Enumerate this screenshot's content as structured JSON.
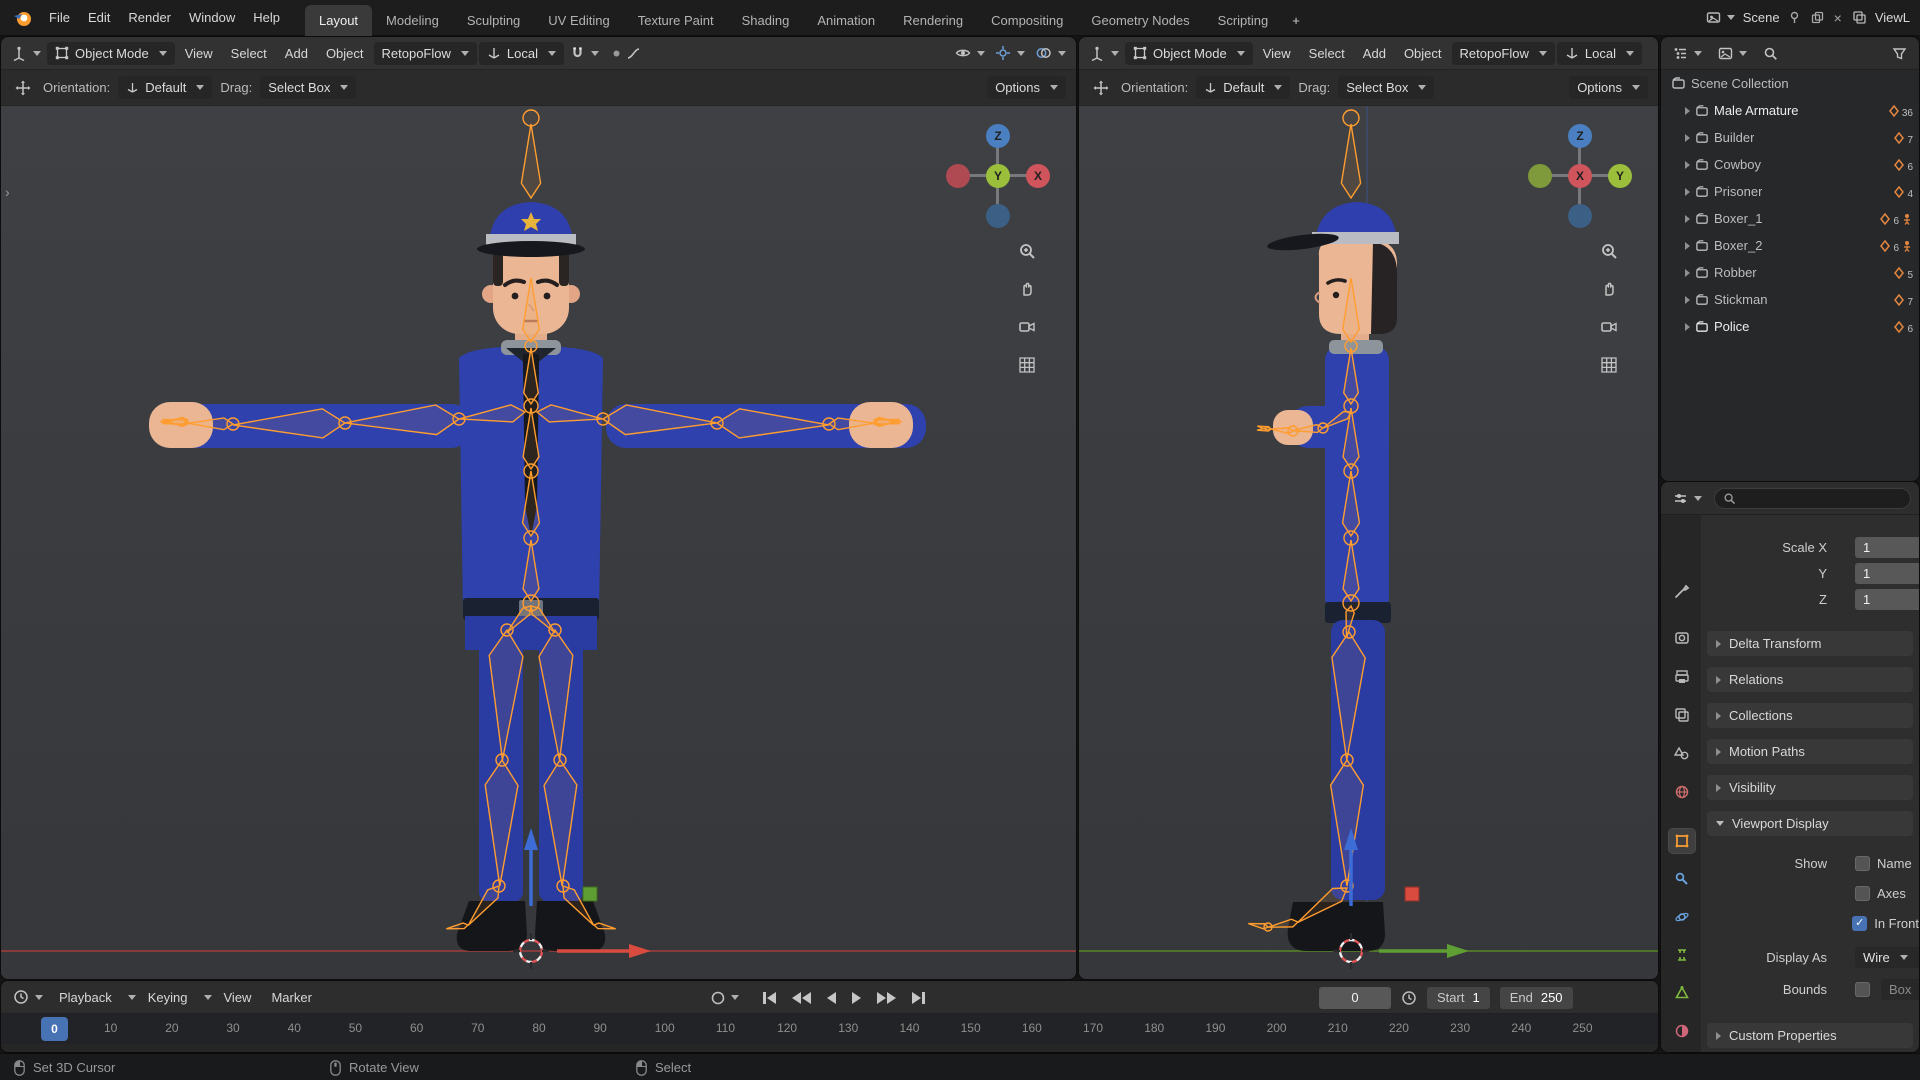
{
  "colors": {
    "accent_blue": "#4772b3",
    "selection_orange": "#ff9d30",
    "axis_x": "#d0545c",
    "axis_y": "#9bbf3b",
    "axis_z": "#4a7fc1",
    "uniform_blue": "#2e41ad"
  },
  "topbar": {
    "menus": [
      "File",
      "Edit",
      "Render",
      "Window",
      "Help"
    ],
    "tabs": [
      "Layout",
      "Modeling",
      "Sculpting",
      "UV Editing",
      "Texture Paint",
      "Shading",
      "Animation",
      "Rendering",
      "Compositing",
      "Geometry Nodes",
      "Scripting"
    ],
    "new_workspace": "+",
    "scene_name": "Scene",
    "view_layer_name": "ViewL"
  },
  "viewport_left": {
    "mode": "Object Mode",
    "menu_view": "View",
    "menu_select": "Select",
    "menu_add": "Add",
    "menu_object": "Object",
    "retopoflow": "RetopoFlow",
    "pivot": "Local",
    "orientation_label": "Orientation:",
    "orientation_value": "Default",
    "drag_label": "Drag:",
    "drag_value": "Select Box",
    "options_label": "Options",
    "axis_top": "Z",
    "axis_center": "Y",
    "axis_right": "X"
  },
  "viewport_right": {
    "mode": "Object Mode",
    "menu_view": "View",
    "menu_select": "Select",
    "menu_add": "Add",
    "menu_object": "Object",
    "retopoflow": "RetopoFlow",
    "pivot": "Local",
    "orientation_label": "Orientation:",
    "orientation_value": "Default",
    "drag_label": "Drag:",
    "drag_value": "Select Box",
    "options_label": "Options",
    "axis_top": "Z",
    "axis_center": "X",
    "axis_right": "Y"
  },
  "outliner": {
    "root": "Scene Collection",
    "items": [
      {
        "name": "Male Armature",
        "count": "36"
      },
      {
        "name": "Builder",
        "count": "7"
      },
      {
        "name": "Cowboy",
        "count": "6"
      },
      {
        "name": "Prisoner",
        "count": "4"
      },
      {
        "name": "Boxer_1",
        "count": "6"
      },
      {
        "name": "Boxer_2",
        "count": "6"
      },
      {
        "name": "Robber",
        "count": "5"
      },
      {
        "name": "Stickman",
        "count": "7"
      },
      {
        "name": "Police",
        "count": "6"
      }
    ]
  },
  "properties": {
    "transform": {
      "scale_x_label": "Scale X",
      "scale_y_label": "Y",
      "scale_z_label": "Z",
      "scale_x": "1",
      "scale_y": "1",
      "scale_z": "1"
    },
    "sections": {
      "delta": "Delta Transform",
      "relations": "Relations",
      "collections": "Collections",
      "motion_paths": "Motion Paths",
      "visibility": "Visibility",
      "viewport_display": "Viewport Display",
      "custom": "Custom Properties"
    },
    "viewport_display": {
      "show_label": "Show",
      "name_label": "Name",
      "axes_label": "Axes",
      "in_front_label": "In Front",
      "display_as_label": "Display As",
      "display_as_value": "Wire",
      "bounds_label": "Bounds",
      "bounds_value": "Box"
    }
  },
  "timeline": {
    "menu_playback": "Playback",
    "menu_keying": "Keying",
    "menu_view": "View",
    "menu_marker": "Marker",
    "current_frame": "0",
    "start_label": "Start",
    "start_value": "1",
    "end_label": "End",
    "end_value": "250",
    "playhead": "0",
    "ticks": [
      "10",
      "20",
      "30",
      "40",
      "50",
      "60",
      "70",
      "80",
      "90",
      "100",
      "110",
      "120",
      "130",
      "140",
      "150",
      "160",
      "170",
      "180",
      "190",
      "200",
      "210",
      "220",
      "230",
      "240",
      "250"
    ]
  },
  "statusbar": {
    "hint_left": "Set 3D Cursor",
    "hint_middle": "Rotate View",
    "hint_right": "Select"
  }
}
